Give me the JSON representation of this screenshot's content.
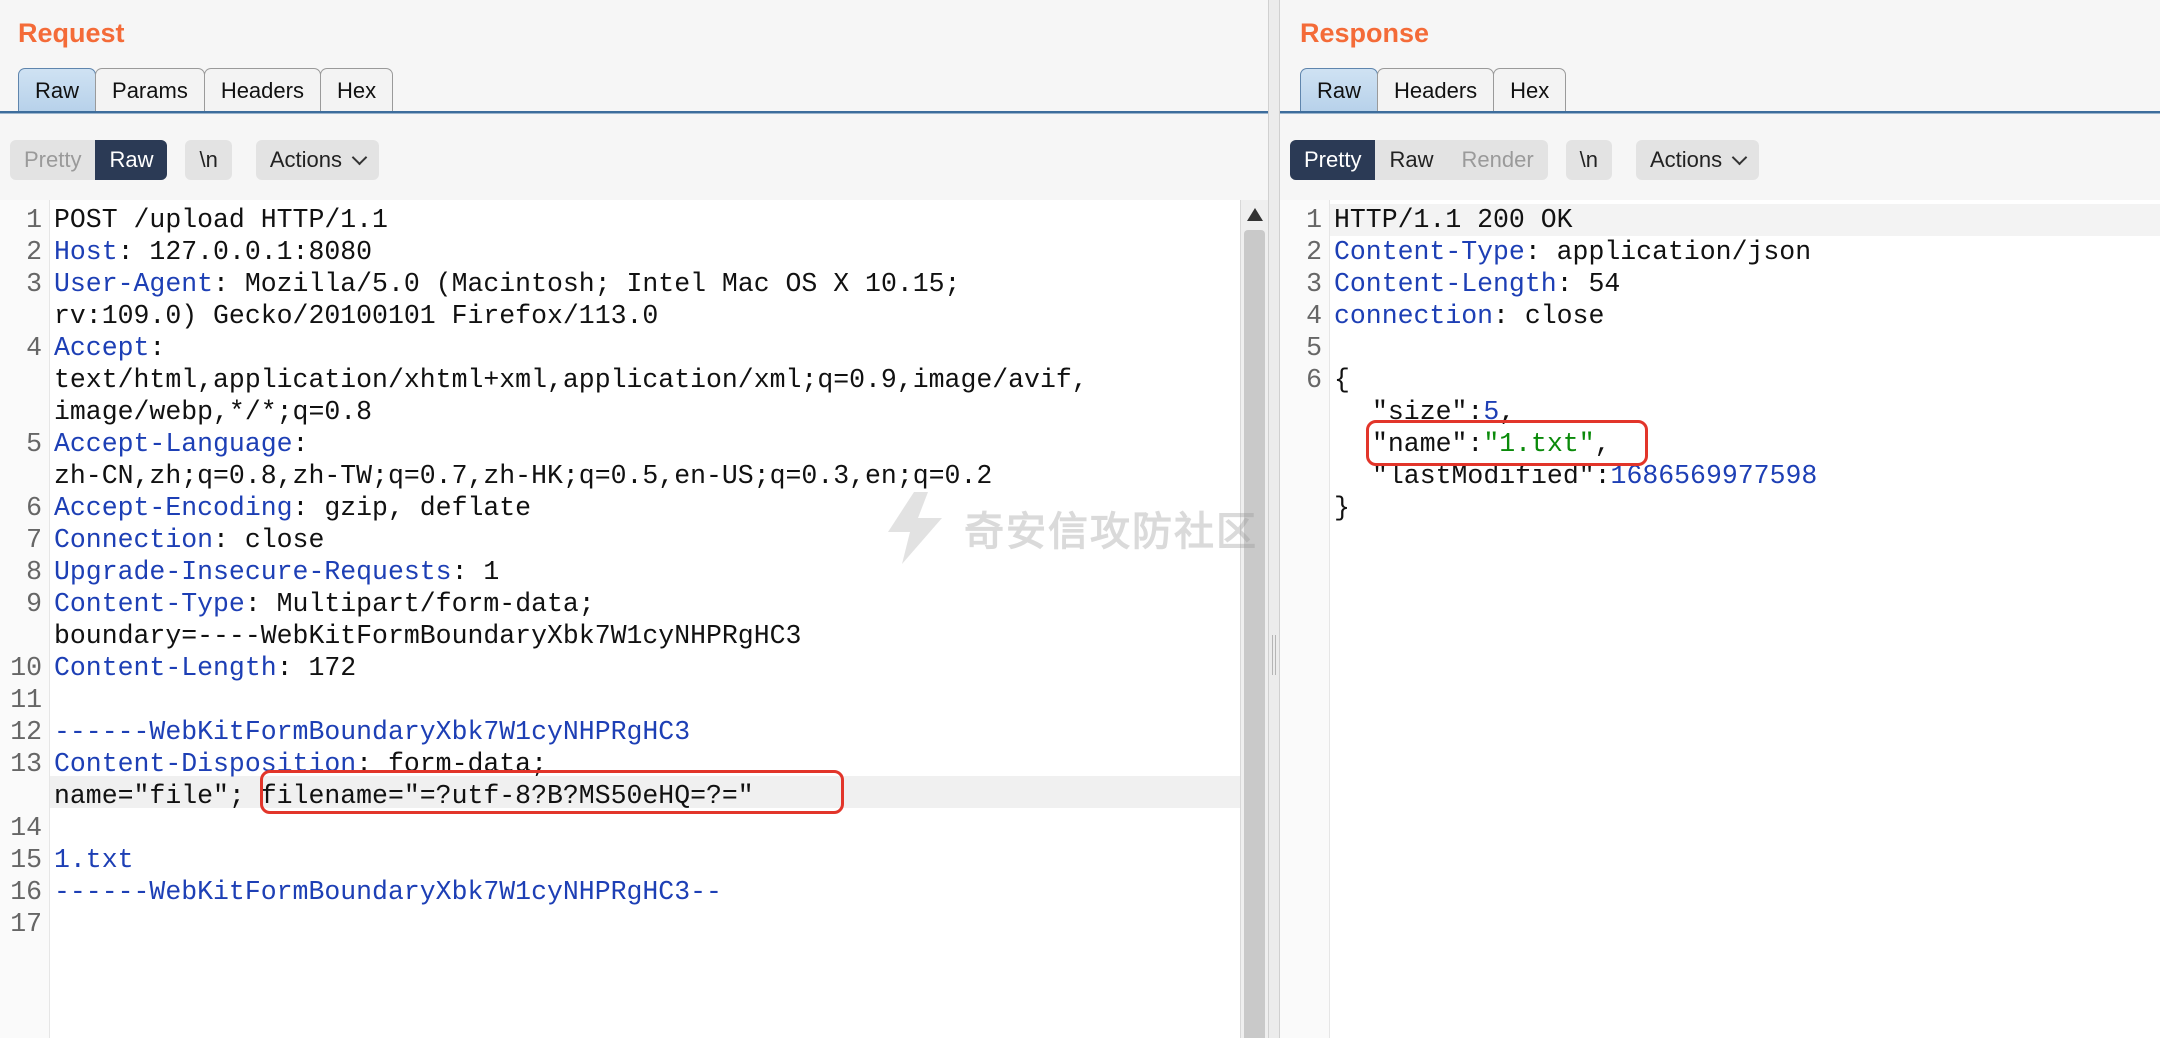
{
  "request": {
    "title": "Request",
    "tabs": [
      "Raw",
      "Params",
      "Headers",
      "Hex"
    ],
    "active_tab": "Raw",
    "view_modes": [
      "Pretty",
      "Raw"
    ],
    "active_view": "Raw",
    "newline_label": "\\n",
    "actions_label": "Actions",
    "line_numbers": [
      "1",
      "2",
      "3",
      "4",
      "5",
      "6",
      "7",
      "8",
      "9",
      "10",
      "11",
      "12",
      "13",
      "14",
      "15",
      "16",
      "17"
    ],
    "lines": {
      "l1": "POST /upload HTTP/1.1",
      "l2_key": "Host",
      "l2_val": ": 127.0.0.1:8080",
      "l3_key": "User-Agent",
      "l3_val": ": Mozilla/5.0 (Macintosh; Intel Mac OS X 10.15;",
      "l3_cont": "rv:109.0) Gecko/20100101 Firefox/113.0",
      "l4_key": "Accept",
      "l4_val": ":",
      "l4_cont1": "text/html,application/xhtml+xml,application/xml;q=0.9,image/avif,",
      "l4_cont2": "image/webp,*/*;q=0.8",
      "l5_key": "Accept-Language",
      "l5_val": ":",
      "l5_cont": "zh-CN,zh;q=0.8,zh-TW;q=0.7,zh-HK;q=0.5,en-US;q=0.3,en;q=0.2",
      "l6_key": "Accept-Encoding",
      "l6_val": ": gzip, deflate",
      "l7_key": "Connection",
      "l7_val": ": close",
      "l8_key": "Upgrade-Insecure-Requests",
      "l8_val": ": 1",
      "l9_key": "Content-Type",
      "l9_val": ": Multipart/form-data;",
      "l9_cont": "boundary=----WebKitFormBoundaryXbk7W1cyNHPRgHC3",
      "l10_key": "Content-Length",
      "l10_val": ": 172",
      "l12": "------WebKitFormBoundaryXbk7W1cyNHPRgHC3",
      "l13_key": "Content-Disposition",
      "l13_val": ": form-data;",
      "l13_cont": "name=\"file\"; filename=\"=?utf-8?B?MS50eHQ=?=\"",
      "l15": "1.txt",
      "l16": "------WebKitFormBoundaryXbk7W1cyNHPRgHC3--"
    }
  },
  "response": {
    "title": "Response",
    "tabs": [
      "Raw",
      "Headers",
      "Hex"
    ],
    "active_tab": "Raw",
    "view_modes": [
      "Pretty",
      "Raw",
      "Render"
    ],
    "active_view": "Pretty",
    "newline_label": "\\n",
    "actions_label": "Actions",
    "line_numbers": [
      "1",
      "2",
      "3",
      "4",
      "5",
      "6"
    ],
    "lines": {
      "l1": "HTTP/1.1 200 OK",
      "l2_key": "Content-Type",
      "l2_val": ": application/json",
      "l3_key": "Content-Length",
      "l3_val": ": 54",
      "l4_key": "connection",
      "l4_val": ": close",
      "l6": "{",
      "size_key": "\"size\"",
      "size_val": "5",
      "name_key": "\"name\"",
      "name_val": "\"1.txt\"",
      "lm_key": "\"lastModified\"",
      "lm_val": "1686569977598",
      "close": "}"
    }
  },
  "watermark": "奇安信攻防社区",
  "colors": {
    "title": "#f46b38",
    "header_key": "#1d3fb5",
    "string_value": "#0a8a0a",
    "highlight_box": "#e2352a",
    "active_segment": "#2b3a55"
  }
}
